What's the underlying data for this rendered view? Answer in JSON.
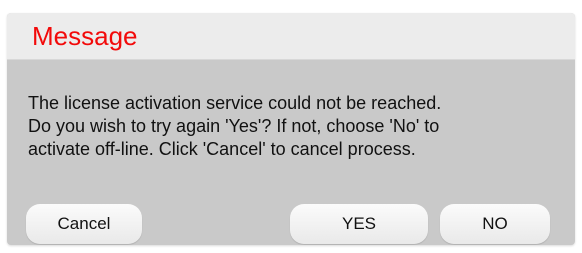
{
  "dialog": {
    "title": "Message",
    "message_lines": [
      "The license activation service could not be reached.",
      "Do you wish to try again 'Yes'? If not, choose 'No' to",
      "activate off-line. Click 'Cancel' to cancel process."
    ],
    "buttons": {
      "cancel_label": "Cancel",
      "yes_label": "YES",
      "no_label": "NO"
    }
  },
  "colors": {
    "title": "#f20a0a",
    "title_bar_bg": "#ececec",
    "body_bg": "#c9c9c9",
    "button_bg": "#f4f4f4"
  }
}
